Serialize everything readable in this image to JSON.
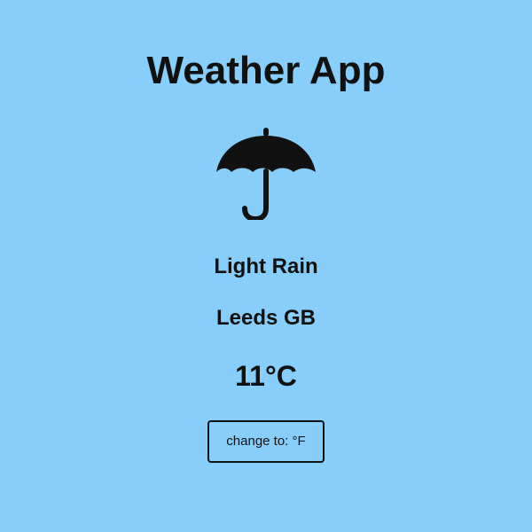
{
  "app": {
    "title": "Weather App"
  },
  "weather": {
    "icon": "umbrella-icon",
    "description": "Light Rain",
    "location": "Leeds GB",
    "temperature": "11°C"
  },
  "controls": {
    "toggle_unit_label": "change to: °F"
  },
  "colors": {
    "background": "#87cefa",
    "text": "#111111",
    "button_border": "#111111"
  }
}
